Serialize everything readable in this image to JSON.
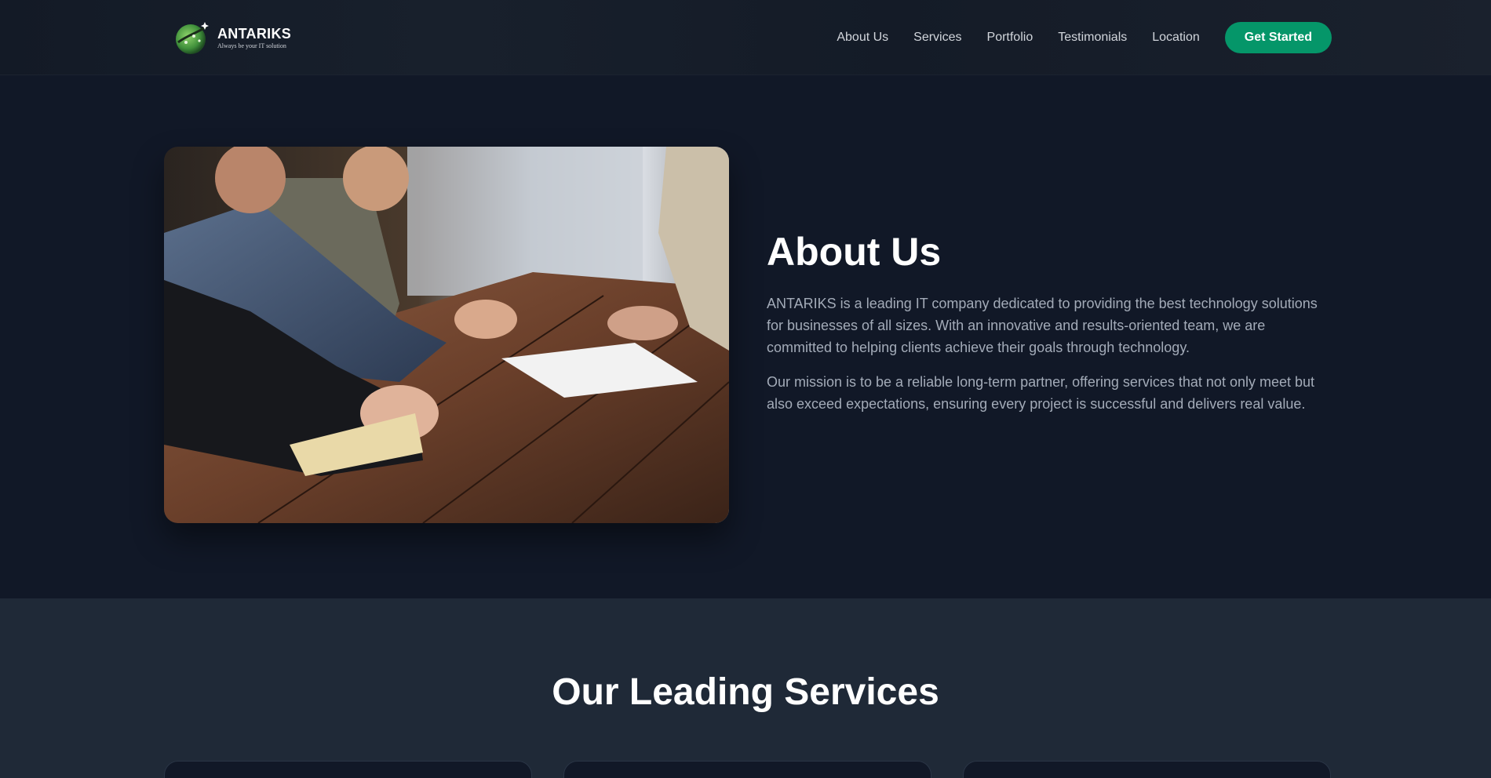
{
  "brand": {
    "name": "ANTARIKS",
    "tagline": "Always be your IT solution"
  },
  "nav": {
    "links": [
      "About Us",
      "Services",
      "Portfolio",
      "Testimonials",
      "Location"
    ],
    "cta": "Get Started"
  },
  "about": {
    "title": "About Us",
    "paragraphs": [
      "ANTARIKS is a leading IT company dedicated to providing the best technology solutions for businesses of all sizes. With an innovative and results-oriented team, we are committed to helping clients achieve their goals through technology.",
      "Our mission is to be a reliable long-term partner, offering services that not only meet but also exceed expectations, ensuring every project is successful and delivers real value."
    ]
  },
  "services": {
    "title": "Our Leading Services"
  },
  "colors": {
    "background": "#111827",
    "section_alt": "#1f2937",
    "accent": "#059669"
  }
}
